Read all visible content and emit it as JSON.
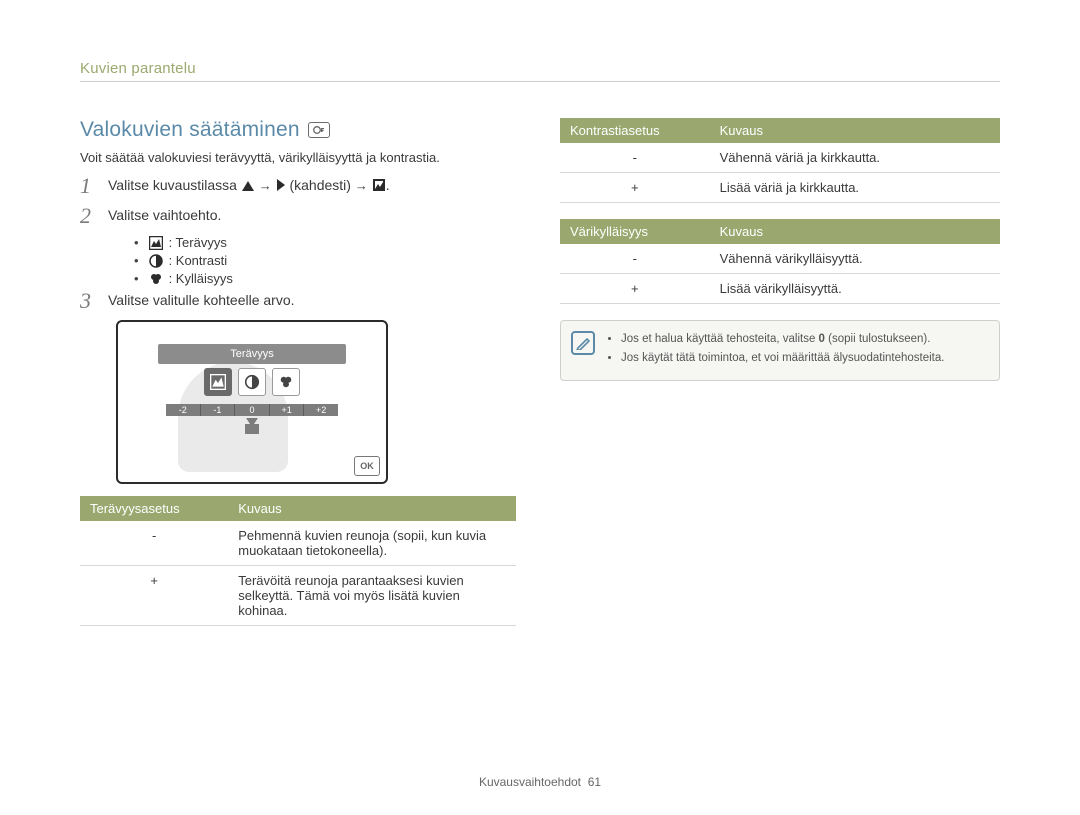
{
  "header": {
    "section": "Kuvien parantelu"
  },
  "title": "Valokuvien säätäminen",
  "mode_icon": "p-mode-icon",
  "intro": "Voit säätää valokuviesi terävyyttä, värikylläisyyttä ja kontrastia.",
  "steps": {
    "s1": {
      "pre": "Valitse kuvaustilassa",
      "mid1": "→",
      "paren": "(kahdesti)",
      "mid2": "→",
      "end": "."
    },
    "s2": {
      "text": "Valitse vaihtoehto."
    },
    "s2_sub": {
      "a": ": Terävyys",
      "b": ": Kontrasti",
      "c": ": Kylläisyys"
    },
    "s3": {
      "text": "Valitse valitulle kohteelle arvo."
    }
  },
  "screen": {
    "label": "Terävyys",
    "scale": [
      "-2",
      "-1",
      "0",
      "+1",
      "+2"
    ],
    "ok": "OK"
  },
  "table_sharp": {
    "h1": "Terävyysasetus",
    "h2": "Kuvaus",
    "r1": {
      "k": "-",
      "v": "Pehmennä kuvien reunoja (sopii, kun kuvia muokataan tietokoneella)."
    },
    "r2": {
      "k": "+",
      "v": "Terävöitä reunoja parantaaksesi kuvien selkeyttä. Tämä voi myös lisätä kuvien kohinaa."
    }
  },
  "table_contrast": {
    "h1": "Kontrastiasetus",
    "h2": "Kuvaus",
    "r1": {
      "k": "-",
      "v": "Vähennä väriä ja kirkkautta."
    },
    "r2": {
      "k": "+",
      "v": "Lisää väriä ja kirkkautta."
    }
  },
  "table_sat": {
    "h1": "Värikylläisyys",
    "h2": "Kuvaus",
    "r1": {
      "k": "-",
      "v": "Vähennä värikylläisyyttä."
    },
    "r2": {
      "k": "+",
      "v": "Lisää värikylläisyyttä."
    }
  },
  "notes": {
    "n1_pre": "Jos et halua käyttää tehosteita, valitse ",
    "n1_bold": "0",
    "n1_post": " (sopii tulostukseen).",
    "n2": "Jos käytät tätä toimintoa, et voi määrittää älysuodatintehosteita."
  },
  "footer": {
    "label": "Kuvausvaihtoehdot",
    "page": "61"
  }
}
